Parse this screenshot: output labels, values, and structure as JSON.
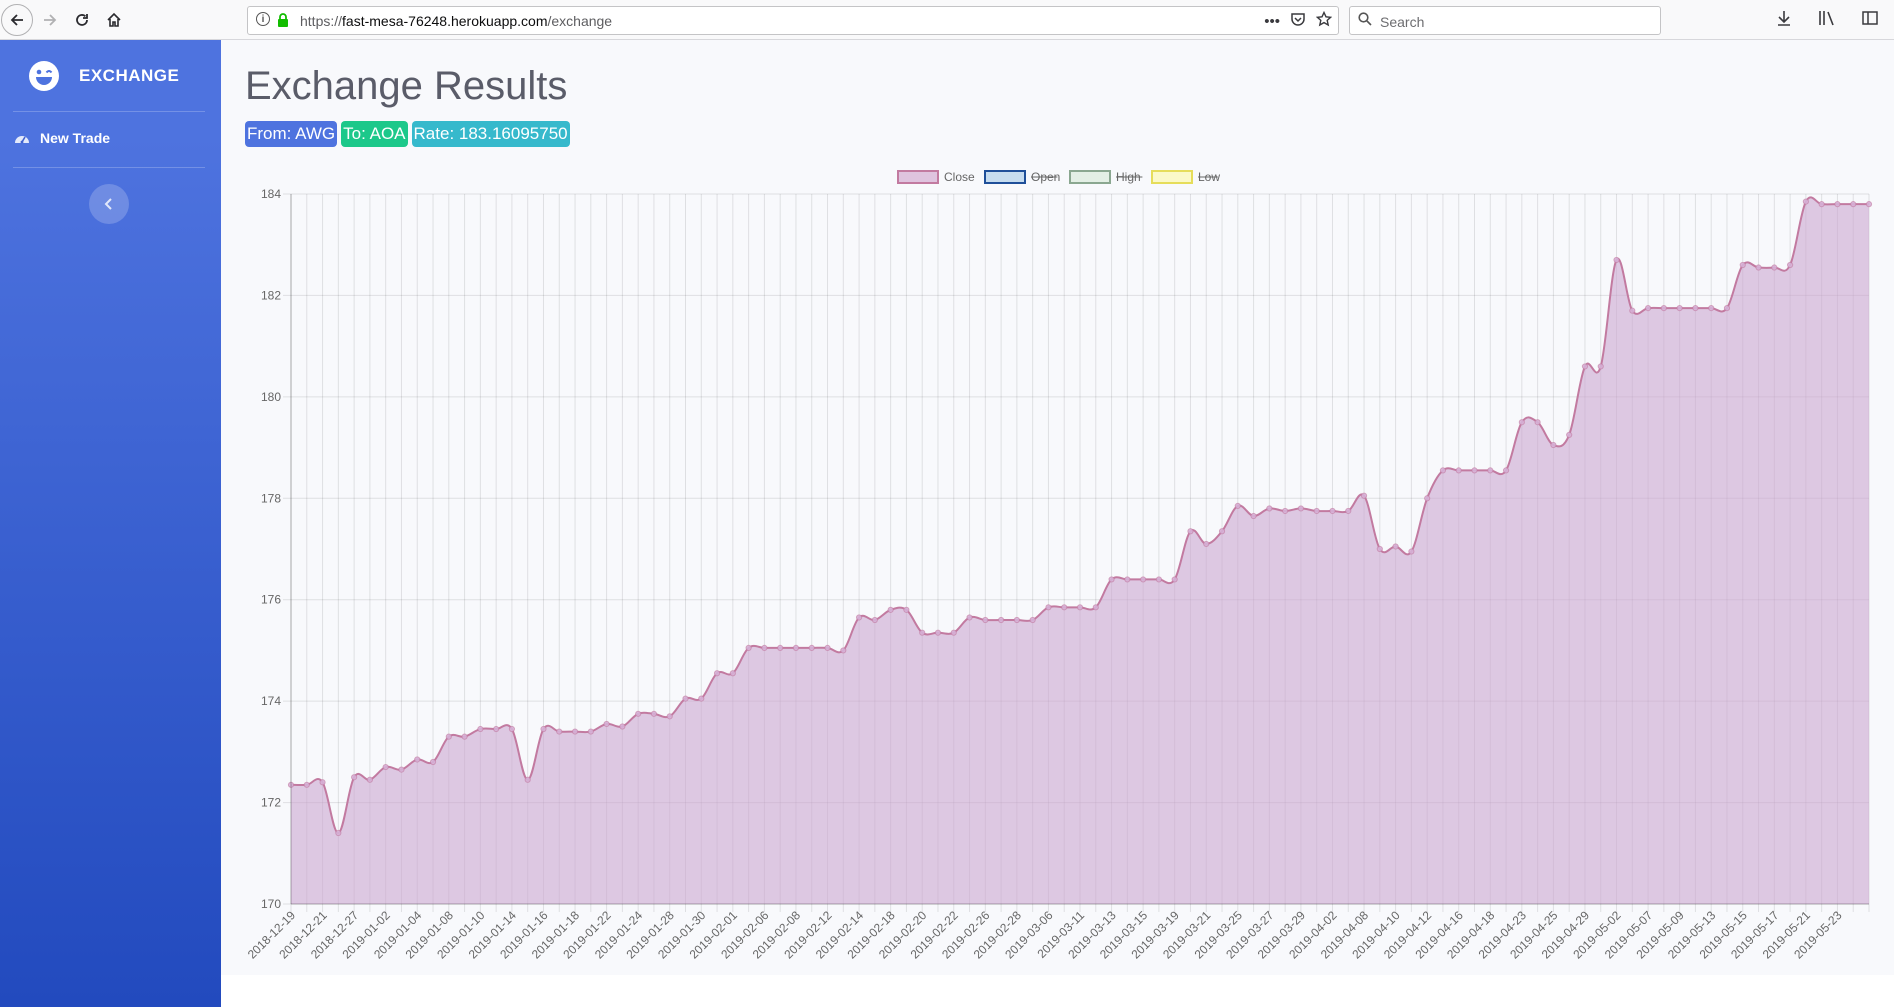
{
  "browser": {
    "url_prefix": "https://",
    "url_host": "fast-mesa-76248.herokuapp.com",
    "url_path": "/exchange",
    "search_placeholder": "Search"
  },
  "sidebar": {
    "brand": "EXCHANGE",
    "items": [
      {
        "label": "New Trade",
        "icon": "tachometer-icon"
      }
    ],
    "toggle_icon": "chevron-left-icon"
  },
  "page": {
    "title": "Exchange Results",
    "badges": {
      "from": "From: AWG",
      "to": "To: AOA",
      "rate": "Rate: 183.16095750"
    }
  },
  "colors": {
    "sidebar_top": "#4e73df",
    "sidebar_bottom": "#224abe",
    "badge_from": "#4e73df",
    "badge_to": "#1cc88a",
    "badge_rate": "#36b9cc",
    "close_fill": "rgba(203,166,209,0.6)",
    "close_line": "#c27aa0"
  },
  "chart_data": {
    "type": "line",
    "legend": [
      {
        "label": "Close",
        "hidden": false,
        "fill": "#dfc3de",
        "stroke": "#c27aa0"
      },
      {
        "label": "Open",
        "hidden": true,
        "fill": "#c6dcef",
        "stroke": "#1f4f99"
      },
      {
        "label": "High",
        "hidden": true,
        "fill": "#e3efe5",
        "stroke": "#8aa790"
      },
      {
        "label": "Low",
        "hidden": true,
        "fill": "#fbf9c8",
        "stroke": "#e6dd5a"
      }
    ],
    "legend_position": "top",
    "ylim": [
      170,
      184
    ],
    "yticks": [
      170,
      172,
      174,
      176,
      178,
      180,
      182,
      184
    ],
    "xticklabels": [
      "2018-12-19",
      "2018-12-21",
      "2018-12-27",
      "2019-01-02",
      "2019-01-04",
      "2019-01-08",
      "2019-01-10",
      "2019-01-14",
      "2019-01-16",
      "2019-01-18",
      "2019-01-22",
      "2019-01-24",
      "2019-01-28",
      "2019-01-30",
      "2019-02-01",
      "2019-02-06",
      "2019-02-08",
      "2019-02-12",
      "2019-02-14",
      "2019-02-18",
      "2019-02-20",
      "2019-02-22",
      "2019-02-26",
      "2019-02-28",
      "2019-03-06",
      "2019-03-11",
      "2019-03-13",
      "2019-03-15",
      "2019-03-19",
      "2019-03-21",
      "2019-03-25",
      "2019-03-27",
      "2019-03-29",
      "2019-04-02",
      "2019-04-08",
      "2019-04-10",
      "2019-04-12",
      "2019-04-16",
      "2019-04-18",
      "2019-04-23",
      "2019-04-25",
      "2019-04-29",
      "2019-05-02",
      "2019-05-07",
      "2019-05-09",
      "2019-05-13",
      "2019-05-15",
      "2019-05-17",
      "2019-05-21",
      "2019-05-23"
    ],
    "grid": true,
    "series": [
      {
        "name": "Close",
        "values": [
          172.35,
          172.35,
          172.4,
          171.4,
          172.5,
          172.45,
          172.7,
          172.65,
          172.85,
          172.8,
          173.3,
          173.3,
          173.45,
          173.45,
          173.45,
          172.45,
          173.45,
          173.4,
          173.4,
          173.4,
          173.55,
          173.5,
          173.75,
          173.75,
          173.7,
          174.05,
          174.05,
          174.55,
          174.55,
          175.05,
          175.05,
          175.05,
          175.05,
          175.05,
          175.05,
          175.0,
          175.65,
          175.6,
          175.8,
          175.8,
          175.35,
          175.35,
          175.35,
          175.65,
          175.6,
          175.6,
          175.6,
          175.6,
          175.85,
          175.85,
          175.85,
          175.85,
          176.4,
          176.4,
          176.4,
          176.4,
          176.4,
          177.35,
          177.1,
          177.35,
          177.85,
          177.65,
          177.8,
          177.75,
          177.8,
          177.75,
          177.75,
          177.75,
          178.05,
          177.0,
          177.05,
          176.95,
          178.0,
          178.55,
          178.55,
          178.55,
          178.55,
          178.55,
          179.5,
          179.5,
          179.05,
          179.25,
          180.6,
          180.6,
          182.7,
          181.7,
          181.75,
          181.75,
          181.75,
          181.75,
          181.75,
          181.75,
          182.6,
          182.55,
          182.55,
          182.6,
          183.85,
          183.8,
          183.8,
          183.8,
          183.8
        ]
      }
    ]
  }
}
